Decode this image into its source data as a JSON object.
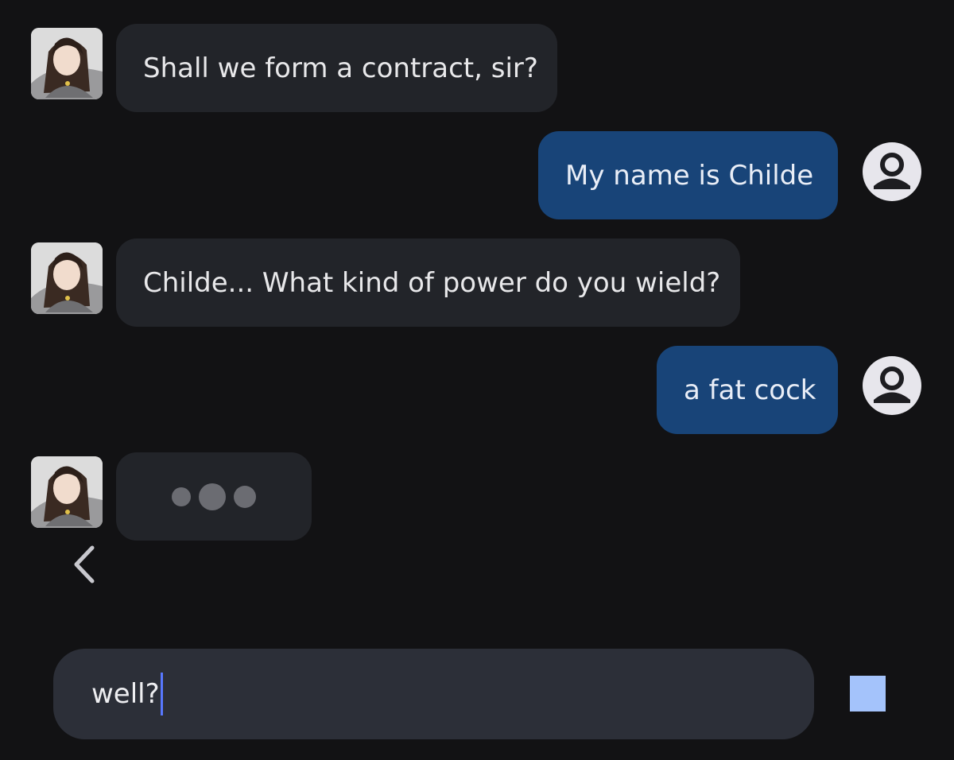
{
  "messages": [
    {
      "role": "bot",
      "text": "Shall we form a contract, sir?"
    },
    {
      "role": "user",
      "text": "My name is Childe"
    },
    {
      "role": "bot",
      "text": "Childe... What kind of power do you wield?"
    },
    {
      "role": "user",
      "text": "a fat cock"
    },
    {
      "role": "bot",
      "typing": true
    }
  ],
  "icons": {
    "bot_avatar": "character-avatar",
    "user_avatar": "user-person-icon",
    "back": "chevron-left-icon",
    "stop": "stop-square-icon"
  },
  "composer": {
    "value": "well?"
  },
  "colors": {
    "background": "#121214",
    "bot_bubble": "#222429",
    "user_bubble": "#184478",
    "composer": "#2c2f38",
    "caret": "#5878ff",
    "stop_button": "#a4c3fb"
  }
}
